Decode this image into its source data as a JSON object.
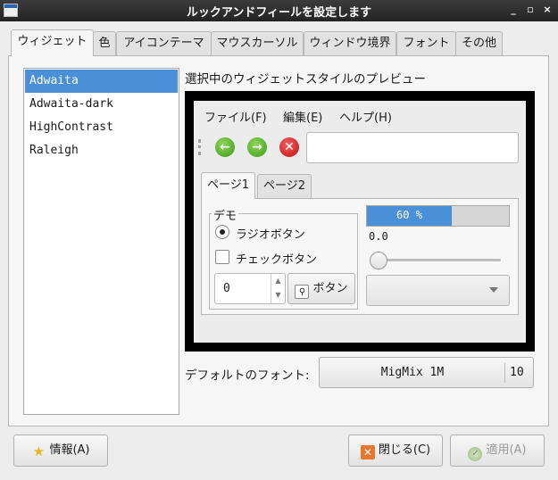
{
  "window": {
    "title": "ルックアンドフィールを設定します",
    "controls": [
      "_",
      "▫",
      "×"
    ]
  },
  "tabs": [
    "ウィジェット",
    "色",
    "アイコンテーマ",
    "マウスカーソル",
    "ウィンドウ境界",
    "フォント",
    "その他"
  ],
  "themes": [
    "Adwaita",
    "Adwaita-dark",
    "HighContrast",
    "Raleigh"
  ],
  "selected_theme": "Adwaita",
  "preview": {
    "label": "選択中のウィジェットスタイルのプレビュー",
    "menu": [
      "ファイル(F)",
      "編集(E)",
      "ヘルプ(H)"
    ],
    "tabs": [
      "ページ1",
      "ページ2"
    ],
    "demo_label": "デモ",
    "radio_label": "ラジオボタン",
    "check_label": "チェックボタン",
    "spin_value": "0",
    "button_label": "ボタン",
    "progress_text": "60 %",
    "progress_fraction": 0.6,
    "scale_value": "0.0"
  },
  "default_font": {
    "label": "デフォルトのフォント:",
    "name": "MigMix 1M",
    "size": "10"
  },
  "buttons": {
    "about": "情報(A)",
    "close": "閉じる(C)",
    "apply": "適用(A)"
  },
  "colors": {
    "accent": "#4a90d9",
    "titlebar": "#2b2b2b"
  }
}
